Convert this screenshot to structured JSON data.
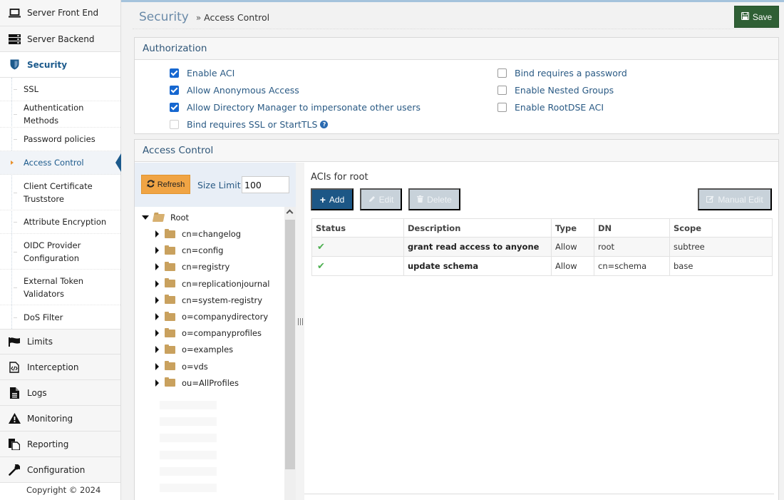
{
  "sidebar": {
    "top_items_before": [
      {
        "label": "Server Front End",
        "icon": "laptop-icon"
      },
      {
        "label": "Server Backend",
        "icon": "server-icon"
      },
      {
        "label": "Security",
        "icon": "shield-icon",
        "active": true
      }
    ],
    "security_sub_items": [
      {
        "label": "SSL"
      },
      {
        "label": "Authentication Methods"
      },
      {
        "label": "Password policies"
      },
      {
        "label": "Access Control",
        "active": true
      },
      {
        "label": "Client Certificate Truststore"
      },
      {
        "label": "Attribute Encryption"
      },
      {
        "label": "OIDC Provider Configuration"
      },
      {
        "label": "External Token Validators"
      },
      {
        "label": "DoS Filter"
      }
    ],
    "top_items_after": [
      {
        "label": "Limits",
        "icon": "flag-icon"
      },
      {
        "label": "Interception",
        "icon": "code-file-icon"
      },
      {
        "label": "Logs",
        "icon": "document-icon"
      },
      {
        "label": "Monitoring",
        "icon": "warning-icon"
      },
      {
        "label": "Reporting",
        "icon": "copy-icon"
      },
      {
        "label": "Configuration",
        "icon": "wrench-icon"
      }
    ],
    "copyright": "Copyright © 2024"
  },
  "header": {
    "breadcrumb_root": "Security",
    "breadcrumb_sep": "»",
    "breadcrumb_leaf": "Access Control",
    "save_label": "Save",
    "save_color": "#2f5f35"
  },
  "authorization": {
    "title": "Authorization",
    "left_options": [
      {
        "label": "Enable ACI",
        "checked": true
      },
      {
        "label": "Allow Anonymous Access",
        "checked": true
      },
      {
        "label": "Allow Directory Manager to impersonate other users",
        "checked": true
      },
      {
        "label": "Bind requires SSL or StartTLS",
        "checked": false,
        "help": true
      }
    ],
    "right_options": [
      {
        "label": "Bind requires a password",
        "checked": false
      },
      {
        "label": "Enable Nested Groups",
        "checked": false
      },
      {
        "label": "Enable RootDSE ACI",
        "checked": false
      }
    ]
  },
  "access_control": {
    "title": "Access Control",
    "refresh_label": "Refresh",
    "size_limit_label": "Size Limit:",
    "size_limit_value": "100",
    "tree": {
      "root": "Root",
      "children": [
        "cn=changelog",
        "cn=config",
        "cn=registry",
        "cn=replicationjournal",
        "cn=system-registry",
        "o=companydirectory",
        "o=companyprofiles",
        "o=examples",
        "o=vds",
        "ou=AllProfiles"
      ]
    },
    "acl_title": "ACIs for root",
    "buttons": {
      "add": "Add",
      "edit": "Edit",
      "delete": "Delete",
      "manual_edit": "Manual Edit"
    },
    "table": {
      "columns": [
        "Status",
        "Description",
        "Type",
        "DN",
        "Scope"
      ],
      "rows": [
        {
          "status": "enabled",
          "description": "grant read access to anyone",
          "type": "Allow",
          "dn": "root",
          "scope": "subtree"
        },
        {
          "status": "enabled",
          "description": "update schema",
          "type": "Allow",
          "dn": "cn=schema",
          "scope": "base"
        }
      ]
    }
  }
}
